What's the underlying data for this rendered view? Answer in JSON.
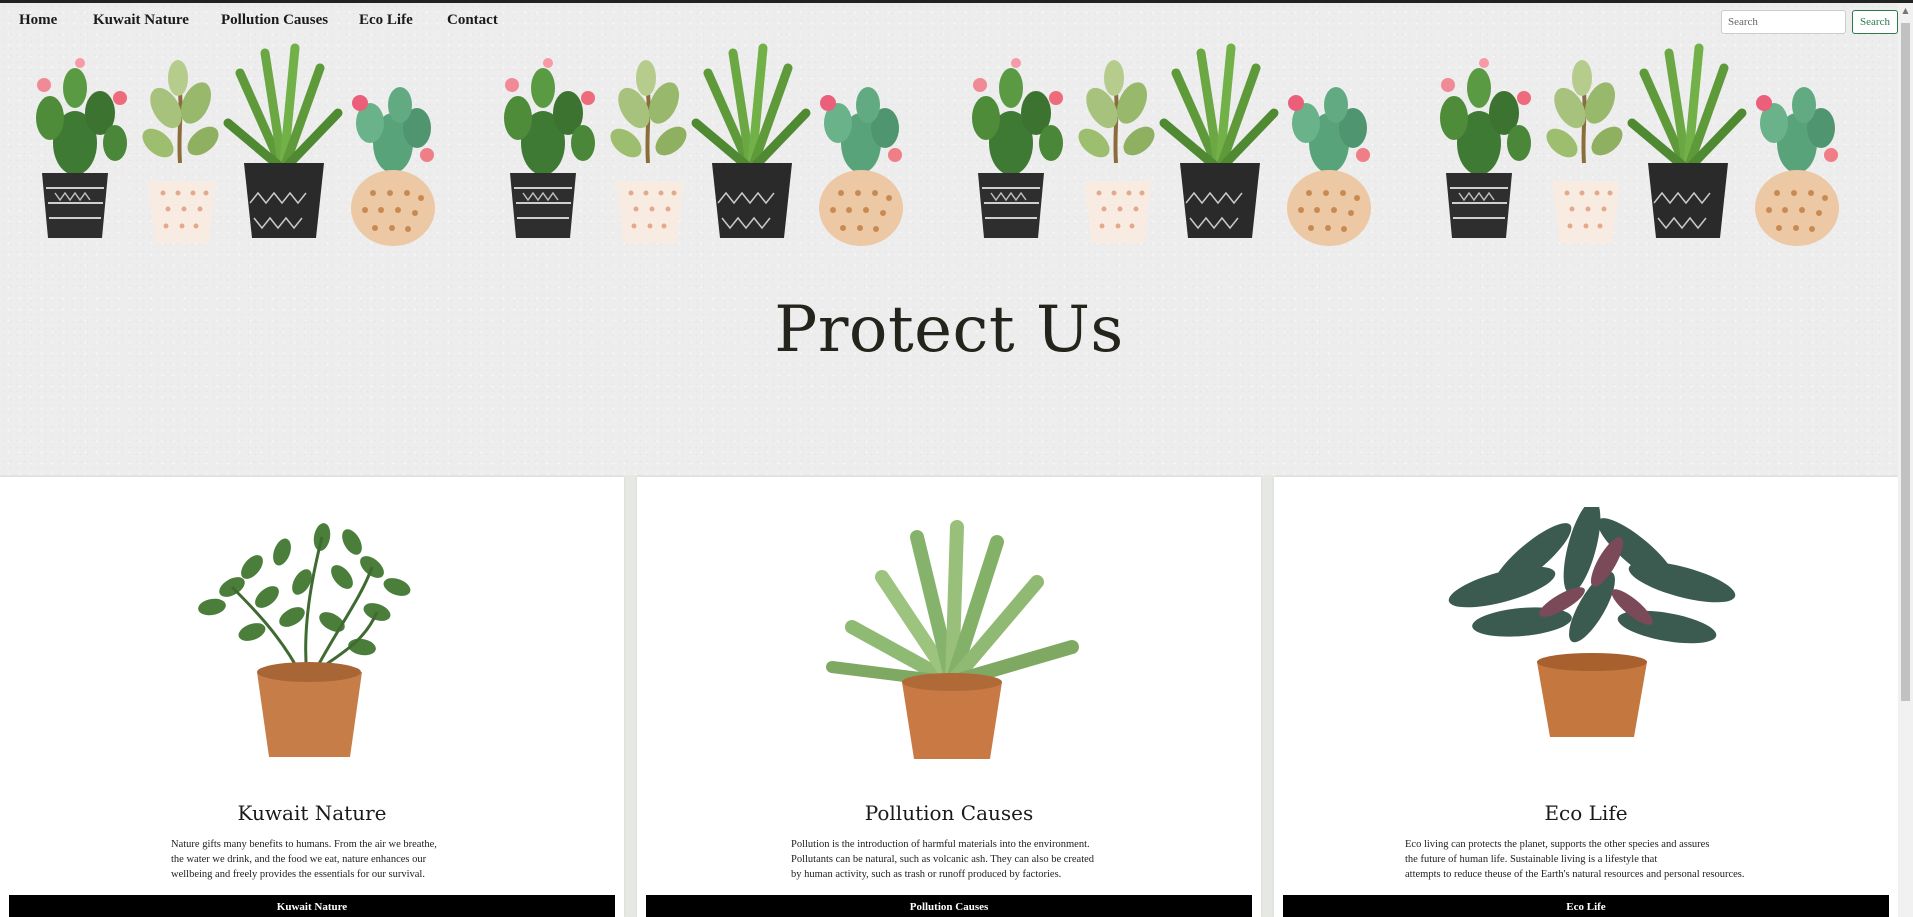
{
  "nav": {
    "links": [
      "Home",
      "Kuwait Nature",
      "Pollution Causes",
      "Eco Life",
      "Contact"
    ],
    "search_placeholder": "Search",
    "search_button": "Search"
  },
  "hero": {
    "title": "Protect Us",
    "decoration": "potted-cactus-row-illustration"
  },
  "cards": [
    {
      "title": "Kuwait Nature",
      "image": "zz-plant-in-terracotta-pot",
      "text": [
        "Nature gifts many benefits to humans. From the air we breathe,",
        "the water we drink, and the food we eat, nature enhances our",
        "wellbeing and freely provides the essentials for our survival."
      ],
      "button": "Kuwait Nature"
    },
    {
      "title": "Pollution Causes",
      "image": "aloe-plant-in-terracotta-pot",
      "text": [
        "Pollution is the introduction of harmful materials into the environment.",
        "Pollutants can be natural, such as volcanic ash. They can also be created",
        "by human activity, such as trash or runoff produced by factories."
      ],
      "button": "Pollution Causes"
    },
    {
      "title": "Eco Life",
      "image": "stromanthe-plant-in-terracotta-pot",
      "text": [
        "Eco living can protects the planet, supports the other species and assures",
        "the future of human life. Sustainable living is a lifestyle that",
        "attempts to reduce theuse of the Earth's natural resources and personal resources."
      ],
      "button": "Eco Life"
    }
  ],
  "colors": {
    "hero_bg": "#ededed",
    "button_bg": "#000000",
    "search_accent": "#2d7a4a",
    "title_color": "#24241c"
  }
}
